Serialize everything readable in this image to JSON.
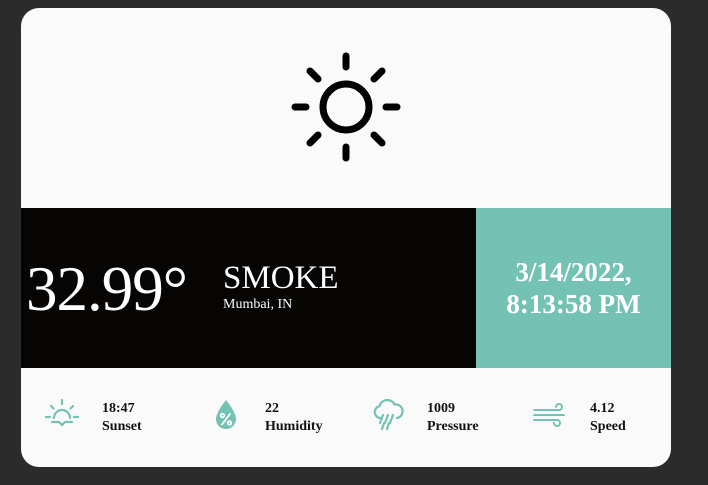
{
  "weather": {
    "icon": "sun-icon",
    "temperature": "32.99°",
    "description": "SMOKE",
    "location": "Mumbai, IN",
    "date": "3/14/2022,",
    "time": "8:13:58 PM"
  },
  "stats": [
    {
      "icon": "sunset-icon",
      "value": "18:47",
      "label": "Sunset"
    },
    {
      "icon": "humidity-icon",
      "value": "22",
      "label": "Humidity"
    },
    {
      "icon": "pressure-icon",
      "value": "1009",
      "label": "Pressure"
    },
    {
      "icon": "wind-icon",
      "value": "4.12",
      "label": "Speed"
    }
  ],
  "colors": {
    "background": "#2b2b2b",
    "card": "#fafafa",
    "dark_band": "#060504",
    "accent": "#74c2b4"
  }
}
